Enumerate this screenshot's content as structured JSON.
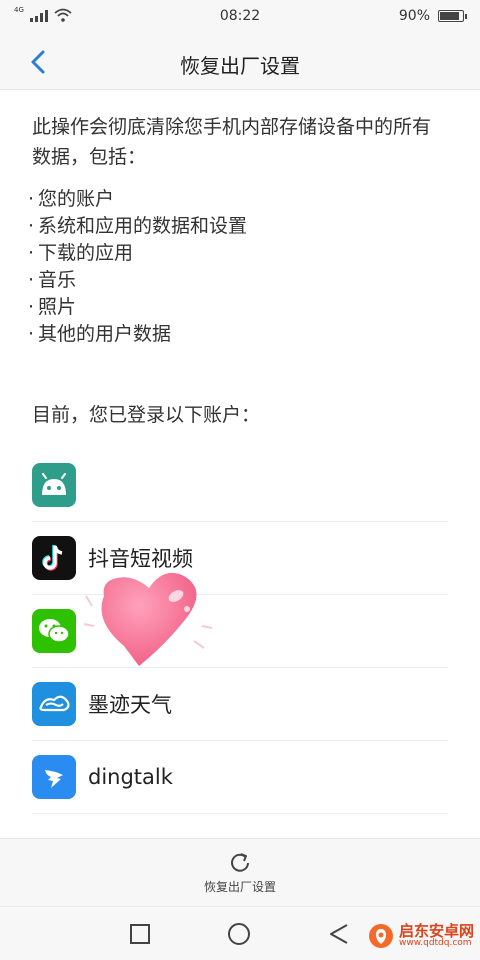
{
  "status_bar": {
    "network": "4G",
    "time": "08:22",
    "battery_text": "90%",
    "battery_level": 0.9
  },
  "header": {
    "title": "恢复出厂设置",
    "back_icon": "chevron-left-icon"
  },
  "content": {
    "intro": "此操作会彻底清除您手机内部存储设备中的所有数据，包括：",
    "items": [
      "您的账户",
      "系统和应用的数据和设置",
      "下载的应用",
      "音乐",
      "照片",
      "其他的用户数据"
    ],
    "accounts_label": "目前，您已登录以下账户："
  },
  "accounts": [
    {
      "name": "",
      "icon": "android-icon",
      "color": "#2e9d8a"
    },
    {
      "name": "抖音短视频",
      "icon": "tiktok-icon",
      "color": "#111111"
    },
    {
      "name": "",
      "icon": "wechat-icon",
      "color": "#2dc100"
    },
    {
      "name": "墨迹天气",
      "icon": "moji-weather-icon",
      "color": "#1f8fe0"
    },
    {
      "name": "dingtalk",
      "icon": "dingtalk-icon",
      "color": "#2a8cf0"
    }
  ],
  "action": {
    "label": "恢复出厂设置",
    "icon": "refresh-icon"
  },
  "nav": {
    "recent_icon": "square-icon",
    "home_icon": "circle-icon",
    "back_icon": "triangle-back-icon"
  },
  "watermark": {
    "name": "启东安卓网",
    "url": "www.qdtdq.com"
  },
  "colors": {
    "accent": "#2a7fd4",
    "background": "#ffffff",
    "bar": "#f7f7f7",
    "watermark": "#d9441c"
  }
}
